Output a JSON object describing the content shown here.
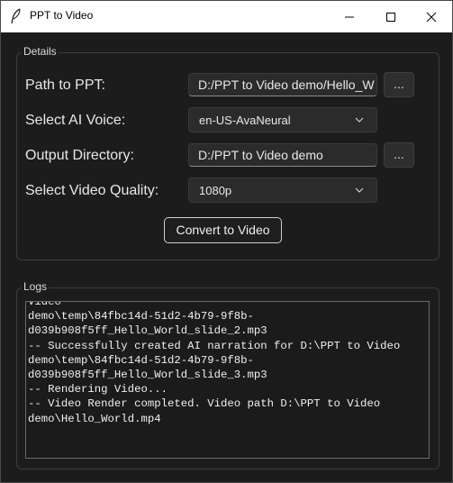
{
  "window": {
    "title": "PPT to Video",
    "icon": "feather-icon"
  },
  "details": {
    "group_label": "Details",
    "ppt_path": {
      "label": "Path to PPT:",
      "value": "D:/PPT to Video demo/Hello_W",
      "browse_label": "..."
    },
    "voice": {
      "label": "Select AI Voice:",
      "selected": "en-US-AvaNeural"
    },
    "output_dir": {
      "label": "Output Directory:",
      "value": "D:/PPT to Video demo",
      "browse_label": "..."
    },
    "quality": {
      "label": "Select Video Quality:",
      "selected": "1080p"
    },
    "convert_label": "Convert to Video"
  },
  "logs": {
    "group_label": "Logs",
    "text": "Video\ndemo\\temp\\84fbc14d-51d2-4b79-9f8b-d039b908f5ff_Hello_World_slide_2.mp3\n-- Successfully created AI narration for D:\\PPT to Video\ndemo\\temp\\84fbc14d-51d2-4b79-9f8b-d039b908f5ff_Hello_World_slide_3.mp3\n-- Rendering Video...\n-- Video Render completed. Video path D:\\PPT to Video\ndemo\\Hello_World.mp4"
  }
}
